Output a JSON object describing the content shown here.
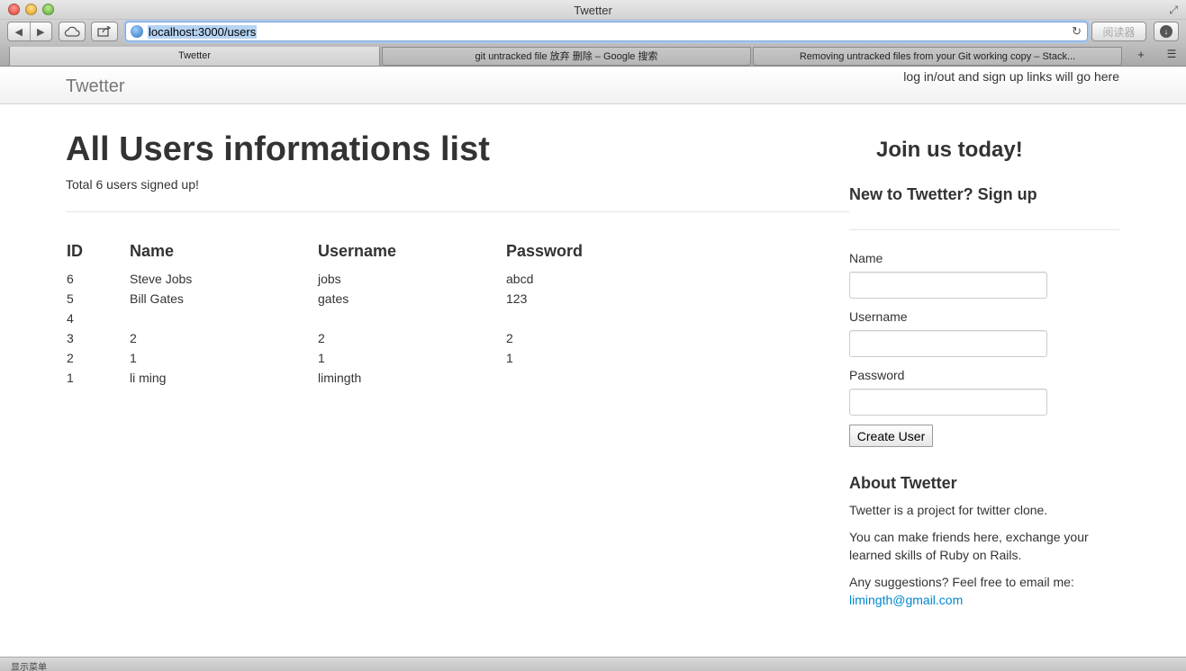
{
  "window": {
    "title": "Twetter"
  },
  "toolbar": {
    "back_icon": "◀",
    "forward_icon": "▶",
    "url": "localhost:3000/users",
    "reader_label": "阅读器"
  },
  "tabs": [
    {
      "label": "Twetter"
    },
    {
      "label": "git untracked file 放弃 删除 – Google 搜索"
    },
    {
      "label": "Removing untracked files from your Git working copy – Stack..."
    }
  ],
  "navbar": {
    "brand": "Twetter",
    "links_text": "log in/out and sign up links will go here"
  },
  "main": {
    "title": "All Users informations list",
    "total_text": "Total 6 users signed up!",
    "columns": [
      "ID",
      "Name",
      "Username",
      "Password"
    ],
    "rows": [
      {
        "id": "6",
        "name": "Steve Jobs",
        "username": "jobs",
        "password": "abcd"
      },
      {
        "id": "5",
        "name": "Bill Gates",
        "username": "gates",
        "password": "123"
      },
      {
        "id": "4",
        "name": "",
        "username": "",
        "password": ""
      },
      {
        "id": "3",
        "name": "2",
        "username": "2",
        "password": "2"
      },
      {
        "id": "2",
        "name": "1",
        "username": "1",
        "password": "1"
      },
      {
        "id": "1",
        "name": "li ming",
        "username": "limingth",
        "password": ""
      }
    ]
  },
  "sidebar": {
    "join_title": "Join us today!",
    "signup_title": "New to Twetter? Sign up",
    "name_label": "Name",
    "username_label": "Username",
    "password_label": "Password",
    "create_button": "Create User",
    "about_title": "About Twetter",
    "about_p1": "Twetter is a project for twitter clone.",
    "about_p2": "You can make friends here, exchange your learned skills of Ruby on Rails.",
    "about_p3": "Any suggestions? Feel free to email me:",
    "email": "limingth@gmail.com"
  },
  "statusbar": {
    "text": "显示菜单"
  }
}
